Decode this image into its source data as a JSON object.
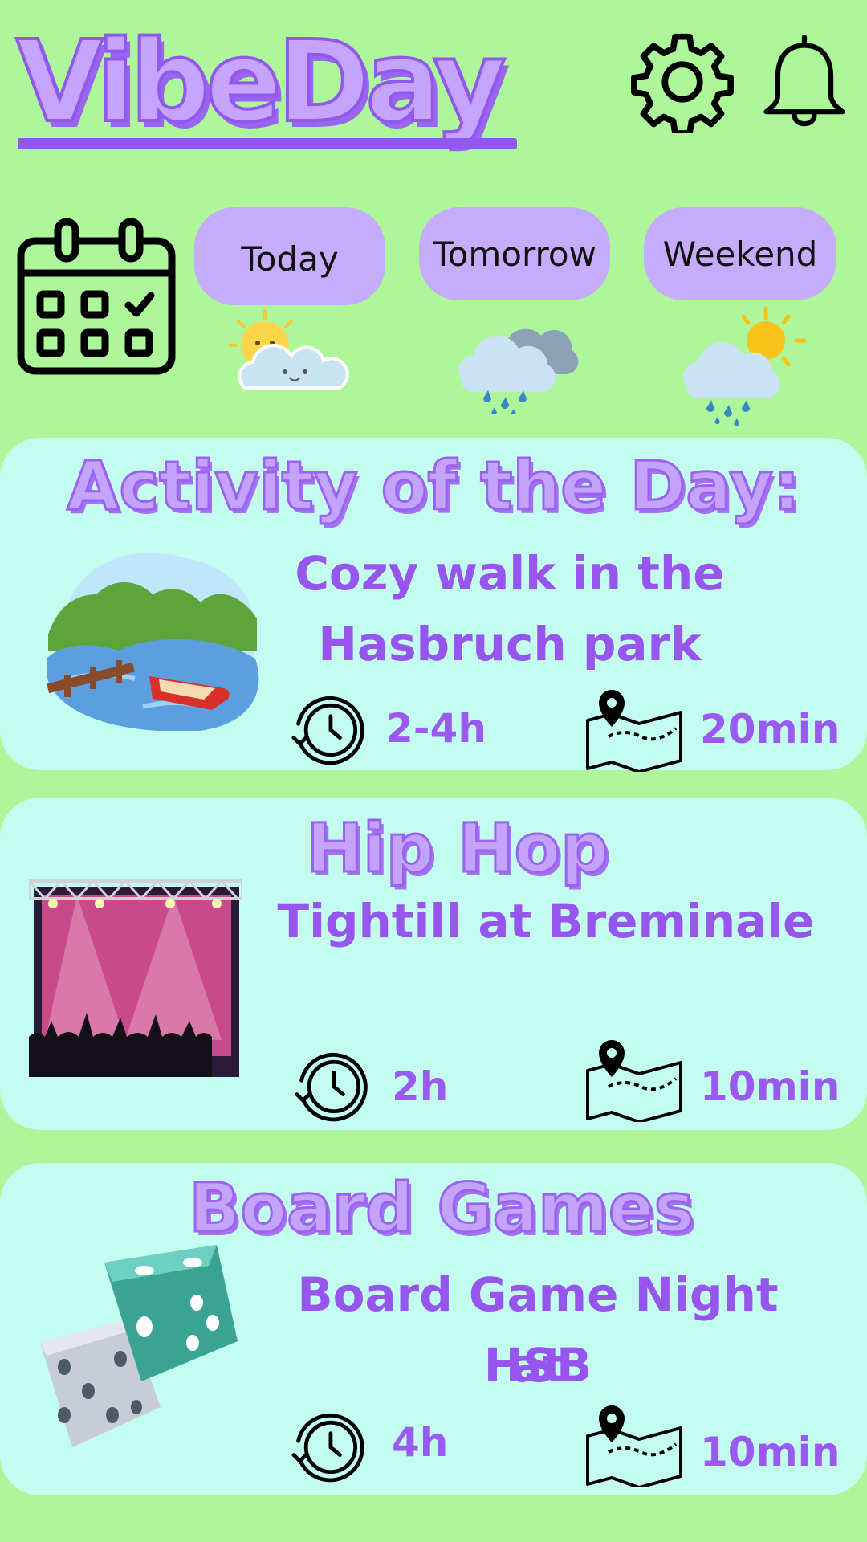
{
  "app": {
    "title": "VibeDay"
  },
  "header": {
    "settings_icon": "gear-icon",
    "notifications_icon": "bell-icon"
  },
  "day_tabs": [
    {
      "label": "Today",
      "weather_icon": "sun-cloud-icon"
    },
    {
      "label": "Tomorrow",
      "weather_icon": "rain-cloud-icon"
    },
    {
      "label": "Weekend",
      "weather_icon": "sun-rain-icon"
    }
  ],
  "cards": [
    {
      "heading": "Activity of the Day:",
      "title_lines": [
        "Cozy walk in the",
        "Hasbruch park"
      ],
      "duration": "2-4h",
      "travel": "20min",
      "image": "lake-with-boat-illustration"
    },
    {
      "heading": "Hip Hop",
      "title_lines": [
        "Tightill at Breminale"
      ],
      "duration": "2h",
      "travel": "10min",
      "image": "concert-stage-illustration"
    },
    {
      "heading": "Board Games",
      "title_lines": [
        "Board Game Night at",
        "HSB"
      ],
      "duration": "4h",
      "travel": "10min",
      "image": "dice-illustration"
    }
  ],
  "colors": {
    "background": "#adf79a",
    "card": "#c2fdf0",
    "accent": "#9656ee",
    "pill": "#c5acfc"
  }
}
